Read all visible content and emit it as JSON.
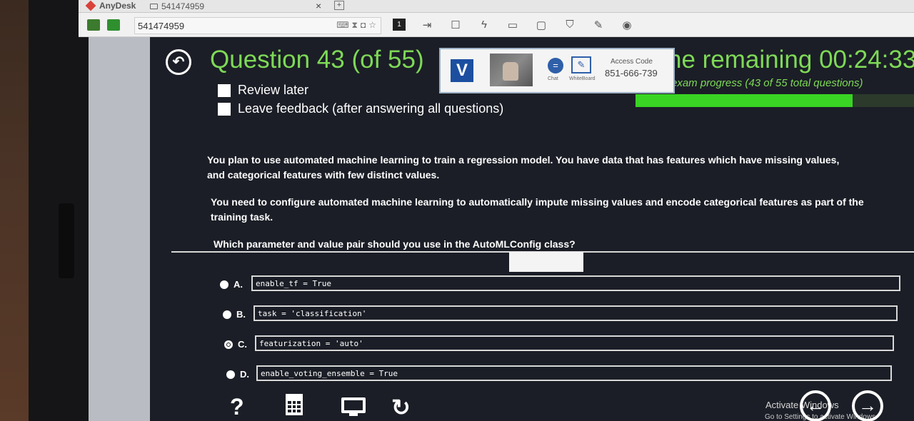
{
  "anydesk": {
    "brand": "AnyDesk",
    "tab_id": "541474959",
    "tab_close": "×",
    "tab_new": "+",
    "address": "541474959",
    "monitor_number": "1"
  },
  "exam": {
    "back_glyph": "↶",
    "title": "Question 43 (of 55)",
    "review_later": "Review later",
    "leave_feedback": "Leave feedback (after answering all questions)",
    "time_remaining": "ne remaining 00:24:33",
    "exam_progress": "exam progress (43 of 55 total questions)",
    "progress_fraction": 0.78
  },
  "overlay": {
    "logo_letter": "V",
    "chat_label": "Chat",
    "whiteboard_label": "WhiteBoard",
    "access_code_label": "Access Code",
    "access_code": "851-666-739"
  },
  "question": {
    "para1": "You plan to use automated machine learning to train a regression model. You have data that has features which have missing values, and categorical features with few distinct values.",
    "para2": "You need to configure automated machine learning to automatically impute missing values and encode categorical features as part of the training task.",
    "prompt": "Which parameter and value pair should you use in the AutoMLConfig class?"
  },
  "options": [
    {
      "letter": "A.",
      "code": "enable_tf = True",
      "selected": false
    },
    {
      "letter": "B.",
      "code": "task = 'classification'",
      "selected": false
    },
    {
      "letter": "C.",
      "code": "featurization = 'auto'",
      "selected": true
    },
    {
      "letter": "D.",
      "code": "enable_voting_ensemble = True",
      "selected": false
    }
  ],
  "footer": {
    "help_glyph": "?",
    "reset_glyph": "↻",
    "prev_glyph": "←",
    "next_glyph": "→",
    "activate_title": "Activate Windows",
    "activate_sub": "Go to Settings to activate Windows."
  }
}
